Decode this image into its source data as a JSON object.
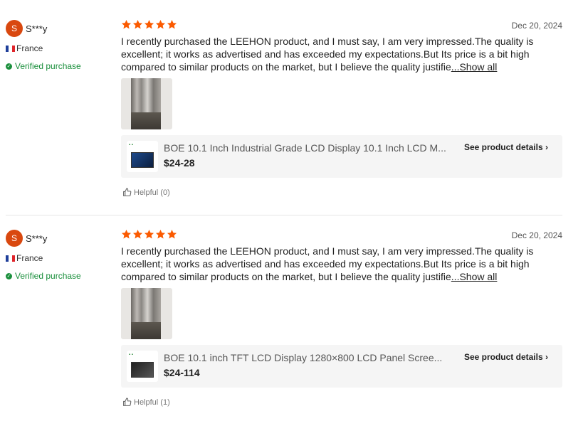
{
  "reviews": [
    {
      "avatar_letter": "S",
      "username": "S***y",
      "country": "France",
      "verified": "Verified purchase",
      "rating": 5,
      "date": "Dec 20, 2024",
      "text": "I recently purchased the LEEHON product, and I must say, I am very impressed.The quality is excellent; it works as advertised and has exceeded my expectations.But Its price is a bit high compared to similar products on the market, but I believe the quality justifie",
      "show_all": "...Show all",
      "product_title": "BOE 10.1 Inch Industrial Grade LCD Display 10.1 Inch LCD M...",
      "product_price": "$24-28",
      "product_details": "See product details",
      "helpful": "Helpful (0)"
    },
    {
      "avatar_letter": "S",
      "username": "S***y",
      "country": "France",
      "verified": "Verified purchase",
      "rating": 5,
      "date": "Dec 20, 2024",
      "text": "I recently purchased the LEEHON product, and I must say, I am very impressed.The quality is excellent; it works as advertised and has exceeded my expectations.But Its price is a bit high compared to similar products on the market, but I believe the quality justifie",
      "show_all": "...Show all",
      "product_title": "BOE 10.1 inch TFT LCD Display 1280×800 LCD Panel Scree...",
      "product_price": "$24-114",
      "product_details": "See product details",
      "helpful": "Helpful (1)"
    }
  ],
  "colors": {
    "star": "#fb5a00",
    "avatar": "#d9480f",
    "verified": "#1a8f3c"
  }
}
